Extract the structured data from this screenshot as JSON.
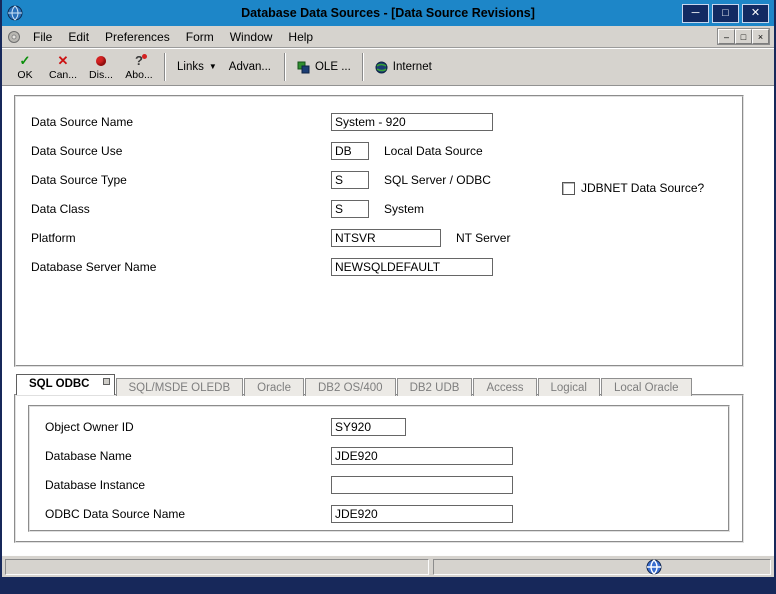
{
  "window": {
    "title": "Database Data Sources - [Data Source Revisions]"
  },
  "colors": {
    "titlebar": "#1d86c8",
    "desktop": "#17285a",
    "chrome": "#d6d3ce",
    "ok_green": "#0a8f0a",
    "cancel_red": "#cc1111"
  },
  "icons": {
    "check": "✓",
    "cross": "✕",
    "question": "?",
    "caret": "▼",
    "minimize": "─",
    "maximize": "□",
    "close": "✕",
    "mdi_minimize": "–",
    "mdi_restore": "□",
    "mdi_close": "×"
  },
  "menu": {
    "items": [
      {
        "label": "File"
      },
      {
        "label": "Edit"
      },
      {
        "label": "Preferences"
      },
      {
        "label": "Form"
      },
      {
        "label": "Window"
      },
      {
        "label": "Help"
      }
    ]
  },
  "toolbar": {
    "ok": "OK",
    "cancel": "Can...",
    "display": "Dis...",
    "about": "Abo...",
    "links": "Links",
    "advanced": "Advan...",
    "ole": "OLE ...",
    "internet": "Internet"
  },
  "form": {
    "rows": [
      {
        "label": "Data Source Name",
        "value": "System - 920",
        "note": ""
      },
      {
        "label": "Data Source Use",
        "value": "DB",
        "note": "Local Data Source"
      },
      {
        "label": "Data Source Type",
        "value": "S",
        "note": "SQL Server / ODBC"
      },
      {
        "label": "Data Class",
        "value": "S",
        "note": "System"
      },
      {
        "label": "Platform",
        "value": "NTSVR",
        "note": "NT Server"
      },
      {
        "label": "Database Server Name",
        "value": "NEWSQLDEFAULT",
        "note": ""
      }
    ],
    "checkbox": {
      "label": "JDBNET Data Source?",
      "checked": false
    }
  },
  "tabs": {
    "items": [
      {
        "label": "SQL ODBC",
        "active": true
      },
      {
        "label": "SQL/MSDE OLEDB",
        "active": false
      },
      {
        "label": "Oracle",
        "active": false
      },
      {
        "label": "DB2 OS/400",
        "active": false
      },
      {
        "label": "DB2 UDB",
        "active": false
      },
      {
        "label": "Access",
        "active": false
      },
      {
        "label": "Logical",
        "active": false
      },
      {
        "label": "Local Oracle",
        "active": false
      }
    ]
  },
  "tab_page": {
    "rows": [
      {
        "label": "Object Owner ID",
        "value": "SY920"
      },
      {
        "label": "Database Name",
        "value": "JDE920"
      },
      {
        "label": "Database Instance",
        "value": ""
      },
      {
        "label": "ODBC Data Source Name",
        "value": "JDE920"
      }
    ]
  }
}
